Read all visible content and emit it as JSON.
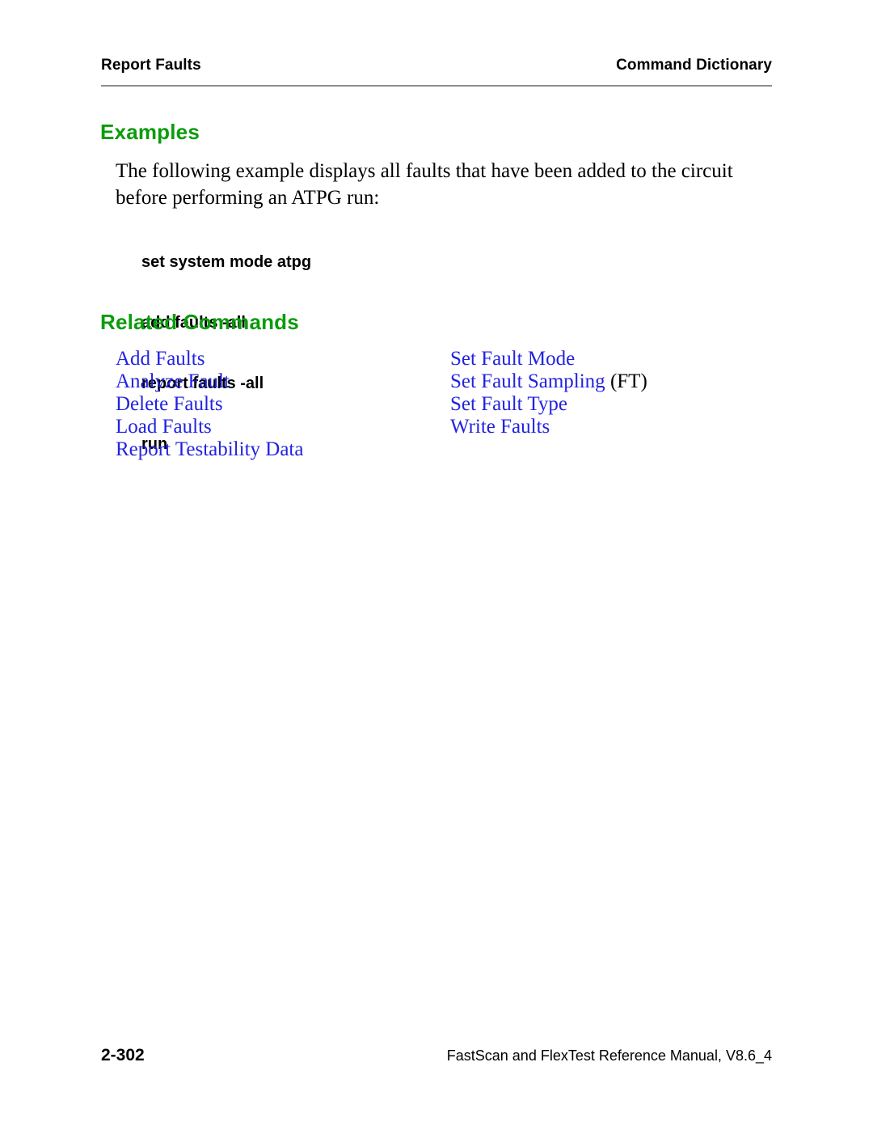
{
  "header": {
    "left_title": "Report Faults",
    "right_title": "Command Dictionary"
  },
  "sections": {
    "examples_heading": "Examples",
    "related_heading": "Related Commands"
  },
  "body": {
    "paragraph": "The following example displays all faults that have been added to the circuit before performing an ATPG run:"
  },
  "code_block": {
    "lines": [
      "set system mode atpg",
      "add faults -all",
      "report faults -all",
      "run"
    ]
  },
  "related_commands": {
    "rows": [
      {
        "left": "Add Faults",
        "right": "Set Fault Mode",
        "right_suffix": ""
      },
      {
        "left": "Analyze Fault",
        "right": "Set Fault Sampling",
        "right_suffix": " (FT)"
      },
      {
        "left": "Delete Faults",
        "right": "Set Fault Type",
        "right_suffix": ""
      },
      {
        "left": "Load Faults",
        "right": "Write Faults",
        "right_suffix": ""
      },
      {
        "left": "Report Testability Data",
        "right": "",
        "right_suffix": ""
      }
    ]
  },
  "footer": {
    "page_number": "2-302",
    "manual": "FastScan and FlexTest Reference Manual, V8.6_4"
  },
  "colors": {
    "heading_green": "#0a9c0a",
    "link_blue": "#2222e0",
    "rule_gray": "#8c8c8c",
    "text_black": "#000000"
  }
}
